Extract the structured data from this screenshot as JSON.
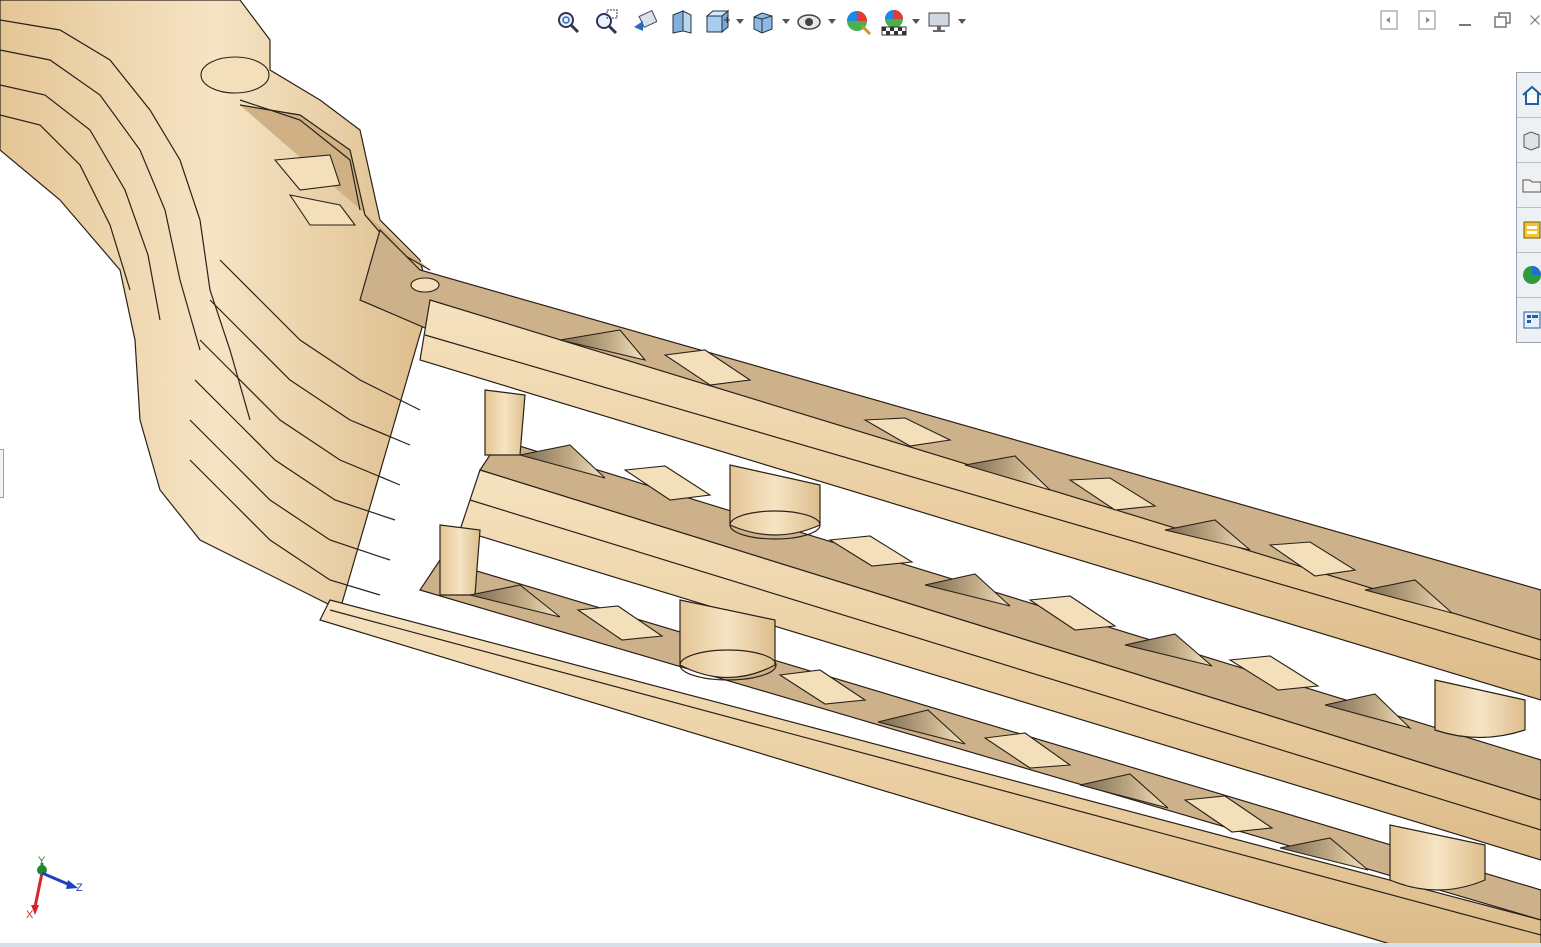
{
  "graphics": {
    "background": "#ffffff",
    "wood_light": "#f2dcb4",
    "wood_mid": "#e2c497",
    "wood_dark": "#c9a878",
    "edge": "#2a2118",
    "shadow": "#8c7a5e"
  },
  "heads_up_toolbar": [
    {
      "id": "zoom-to-fit",
      "icon": "zoom-to-fit-icon"
    },
    {
      "id": "zoom-to-area",
      "icon": "zoom-to-area-icon"
    },
    {
      "id": "previous-view",
      "icon": "previous-view-icon"
    },
    {
      "id": "section-view",
      "icon": "section-view-icon"
    },
    {
      "id": "view-orientation",
      "icon": "view-orientation-icon",
      "dropdown": true
    },
    {
      "id": "display-style",
      "icon": "display-style-icon",
      "dropdown": true
    },
    {
      "id": "hide-show-items",
      "icon": "hide-show-eye-icon",
      "dropdown": true
    },
    {
      "id": "edit-appearance",
      "icon": "edit-appearance-icon"
    },
    {
      "id": "apply-scene",
      "icon": "apply-scene-icon",
      "dropdown": true
    },
    {
      "id": "view-settings",
      "icon": "view-settings-monitor-icon",
      "dropdown": true
    }
  ],
  "window_controls": [
    "split-left-icon",
    "split-right-icon",
    "minimize-icon",
    "restore-icon",
    "close-icon"
  ],
  "task_pane": [
    {
      "id": "home",
      "icon": "home-icon"
    },
    {
      "id": "design-library",
      "icon": "design-library-icon"
    },
    {
      "id": "file-explorer",
      "icon": "folder-icon"
    },
    {
      "id": "view-palette",
      "icon": "view-palette-icon"
    },
    {
      "id": "appearances",
      "icon": "appearances-globe-icon"
    },
    {
      "id": "custom-properties",
      "icon": "custom-properties-icon"
    }
  ],
  "triad": {
    "x_label": "X",
    "y_label": "Y",
    "z_label": "Z",
    "x_color": "#d8232a",
    "y_color": "#1f8a2c",
    "z_color": "#1f3fbf"
  }
}
